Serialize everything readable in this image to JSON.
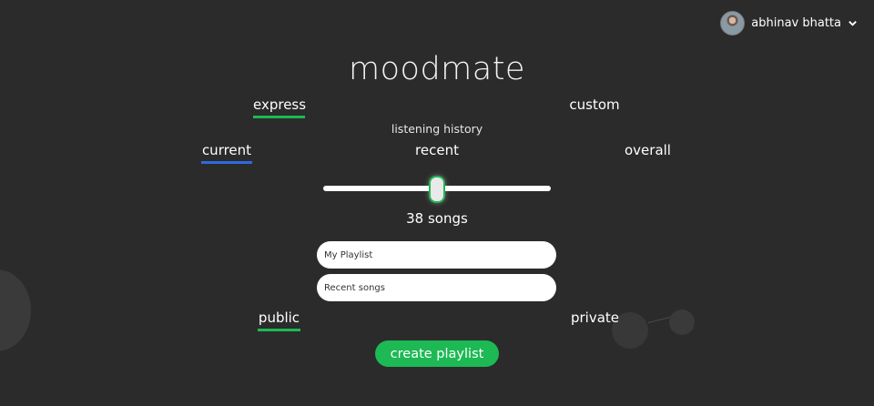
{
  "brand": {
    "name": "moodmate"
  },
  "user": {
    "name": "abhinav bhatta",
    "avatar_icon": "user-avatar",
    "menu_icon": "chevron-down-icon"
  },
  "modes": {
    "express": "express",
    "custom": "custom",
    "active": "express"
  },
  "history": {
    "label": "listening history",
    "options": {
      "current": "current",
      "recent": "recent",
      "overall": "overall"
    },
    "active": "current"
  },
  "slider": {
    "value_fraction": 0.5
  },
  "song_count": "38 songs",
  "playlist_name": {
    "value": "My Playlist"
  },
  "playlist_description": {
    "value": "Recent songs"
  },
  "visibility": {
    "public": "public",
    "private": "private",
    "active": "public"
  },
  "create_button": {
    "label": "create playlist"
  },
  "colors": {
    "background": "#2b2b2b",
    "accent_green": "#1db954",
    "accent_blue": "#2e6ae0"
  }
}
